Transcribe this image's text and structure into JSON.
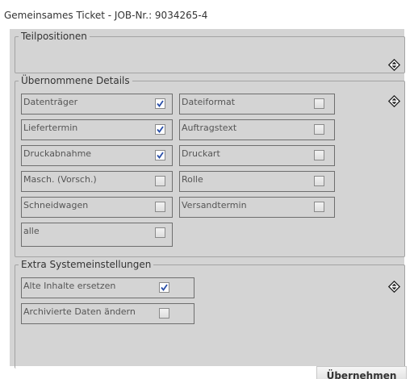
{
  "window": {
    "title": "Gemeinsames Ticket - JOB-Nr.: 9034265-4"
  },
  "sections": {
    "teilpositionen": {
      "legend": "Teilpositionen"
    },
    "details": {
      "legend": "Übernommene Details",
      "items": [
        {
          "label": "Datenträger",
          "checked": true
        },
        {
          "label": "Dateiformat",
          "checked": false
        },
        {
          "label": "Liefertermin",
          "checked": true
        },
        {
          "label": "Auftragstext",
          "checked": false
        },
        {
          "label": "Druckabnahme",
          "checked": true
        },
        {
          "label": "Druckart",
          "checked": false
        },
        {
          "label": "Masch. (Vorsch.)",
          "checked": false
        },
        {
          "label": "Rolle",
          "checked": false
        },
        {
          "label": "Schneidwagen",
          "checked": false
        },
        {
          "label": "Versandtermin",
          "checked": false
        },
        {
          "label": "alle",
          "checked": false
        }
      ]
    },
    "extra": {
      "legend": "Extra Systemeinstellungen",
      "items": [
        {
          "label": "Alte Inhalte ersetzen",
          "checked": true
        },
        {
          "label": "Archivierte Daten ändern",
          "checked": false
        }
      ]
    }
  },
  "actions": {
    "submit_label": "Übernehmen"
  },
  "icons": {
    "collapse": "expand-collapse-diamond-icon",
    "check": "checkmark-icon"
  },
  "colors": {
    "panel": "#d4d4d4",
    "check": "#2a4fa8"
  }
}
